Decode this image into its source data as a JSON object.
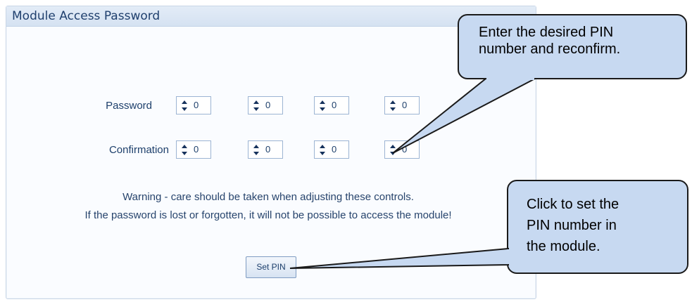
{
  "panel": {
    "title": "Module Access Password"
  },
  "password": {
    "label": "Password",
    "digits": [
      "0",
      "0",
      "0",
      "0"
    ]
  },
  "confirmation": {
    "label": "Confirmation",
    "digits": [
      "0",
      "0",
      "0",
      "0"
    ]
  },
  "warning": {
    "line1": "Warning - care should be taken when adjusting these controls.",
    "line2": "If the password is lost or forgotten, it will not be possible to access the module!"
  },
  "set_pin_button": {
    "label": "Set PIN"
  },
  "callout_top": {
    "line1": "Enter the desired PIN",
    "line2": "number and reconfirm."
  },
  "callout_bottom": {
    "line1": "Click to set the",
    "line2": "PIN number in",
    "line3": "the module."
  },
  "colors": {
    "callout_fill": "#c7d9f1",
    "panel_title": "#20406e",
    "text": "#1d3f6b"
  }
}
